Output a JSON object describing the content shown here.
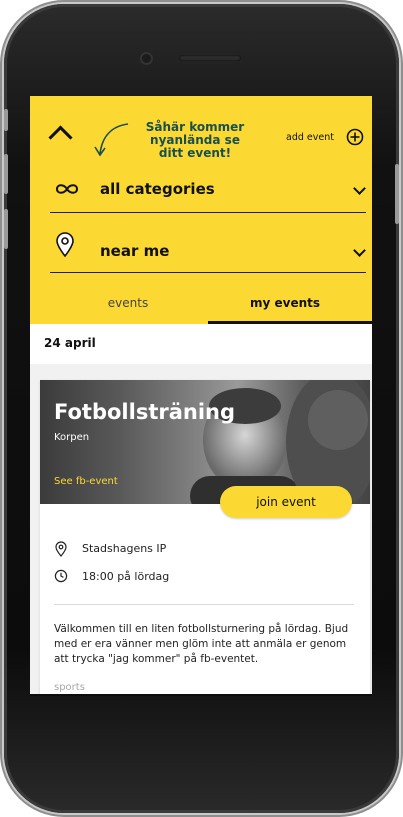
{
  "header": {
    "annotation": "Såhär kommer nyanlända se ditt event!",
    "add_event_label": "add event",
    "filters": {
      "category_label": "all categories",
      "location_label": "near me"
    },
    "tabs": [
      {
        "label": "events",
        "active": false
      },
      {
        "label": "my events",
        "active": true
      }
    ]
  },
  "date_section": {
    "date": "24 april"
  },
  "event_card": {
    "title": "Fotbollsträning",
    "organizer": "Korpen",
    "fb_link": "See fb-event",
    "join_label": "join event",
    "location": "Stadshagens IP",
    "time": "18:00 på lördag",
    "description": "Välkommen till en liten fotbollsturnering på lördag. Bjud med er era vänner men glöm inte att anmäla er genom att trycka \"jag kommer\" på fb-eventet.",
    "tag": "sports"
  },
  "colors": {
    "accent_yellow": "#fbd932",
    "annotation_teal": "#1a4f4f"
  },
  "icons": {
    "collapse": "chevron-up-icon",
    "add": "plus-circle-icon",
    "category": "infinity-icon",
    "location": "location-pin-icon",
    "time": "clock-icon"
  }
}
